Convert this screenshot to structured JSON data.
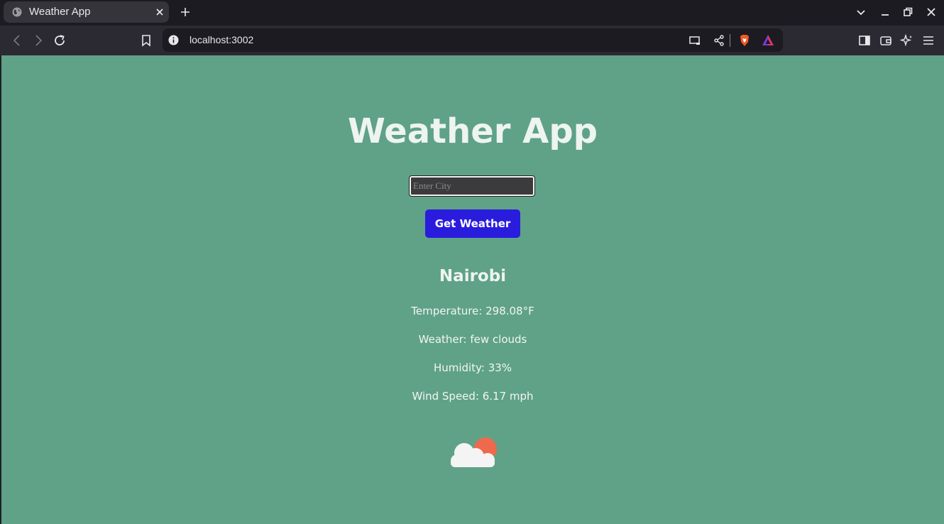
{
  "browser": {
    "tab": {
      "title": "Weather App",
      "favicon": "globe-icon"
    },
    "address": {
      "url": "localhost:3002"
    },
    "toolbar_icons": [
      "back-icon",
      "forward-icon",
      "reload-icon",
      "bookmark-icon",
      "info-icon",
      "cast-icon",
      "share-icon",
      "brave-shield-icon",
      "brave-rewards-icon",
      "sidebar-icon",
      "wallet-icon",
      "leo-ai-icon",
      "menu-icon"
    ]
  },
  "app": {
    "title": "Weather App",
    "search": {
      "placeholder": "Enter City",
      "value": ""
    },
    "button_label": "Get Weather",
    "result": {
      "city": "Nairobi",
      "temperature": "Temperature: 298.08°F",
      "weather": "Weather: few clouds",
      "humidity": "Humidity: 33%",
      "wind": "Wind Speed: 6.17 mph",
      "icon": "few-clouds-icon"
    }
  },
  "colors": {
    "page_background": "#5fa287",
    "button": "#2a1cdc",
    "sun": "#ee6a4c",
    "cloud": "#f4f4f4"
  }
}
